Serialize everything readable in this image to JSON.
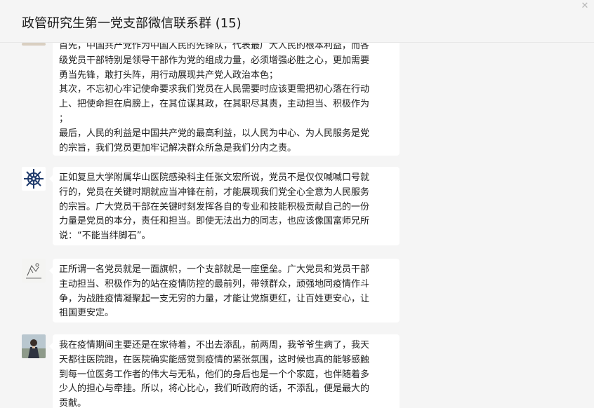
{
  "header": {
    "title": "政管研究生第一党支部微信联系群 (15)",
    "close_label": "✕"
  },
  "messages": [
    {
      "avatar": "landscape-photo-avatar",
      "lines": [
        "首先，中国共产党作为中国人民的先锋队，代表最广大人民的根本利益，而各",
        "级党员干部特别是领导干部作为党的组成力量，必须增强必胜之心，更加需要",
        "勇当先锋，敢打头阵，用行动展现共产党人政治本色；",
        "其次，不忘初心牢记使命要求我们党员在人民需要时应该更需把初心落在行动",
        "上、把使命担在肩膀上，在其位谋其政，在其职尽其责，主动担当、积极作为",
        "；",
        "最后，人民的利益是中国共产党的最高利益，以人民为中心、为人民服务是党",
        "的宗旨，我们党员更加牢记解决群众所急是我们分内之责。"
      ]
    },
    {
      "avatar": "ship-wheel-logo-avatar",
      "lines": [
        "正如复旦大学附属华山医院感染科主任张文宏所说，党员不是仅仅喊喊口号就",
        "行的，党员在关键时期就应当冲锋在前，才能展现我们党全心全意为人民服务",
        "的宗旨。广大党员干部在关键时刻发挥各自的专业和技能积极贡献自己的一份",
        "力量是党员的本分，责任和担当。即使无法出力的同志，也应该像国富师兄所",
        "说：“不能当绊脚石”。"
      ]
    },
    {
      "avatar": "sketch-drawing-avatar",
      "lines": [
        "正所谓一名党员就是一面旗帜，一个支部就是一座堡垒。广大党员和党员干部",
        "主动担当、积极作为的站在疫情防控的最前列，带领群众，顽强地同疫情作斗",
        "争，为战胜疫情凝聚起一支无穷的力量，才能让党旗更红，让百姓更安心，让",
        "祖国更安定。"
      ]
    },
    {
      "avatar": "person-photo-avatar",
      "lines": [
        "我在疫情期间主要还是在家待着，不出去添乱，前两周，我爷爷生病了，我天",
        "天都往医院跑，在医院确实能感觉到疫情的紧张氛围，这时候也真的能够感触",
        "到每一位医务工作者的伟大与无私，他们的身后也是一个个家庭，也伴随着多",
        "少人的担心与牵挂。所以，将心比心，我们听政府的话，不添乱，便是最大的",
        "贡献。"
      ]
    }
  ]
}
